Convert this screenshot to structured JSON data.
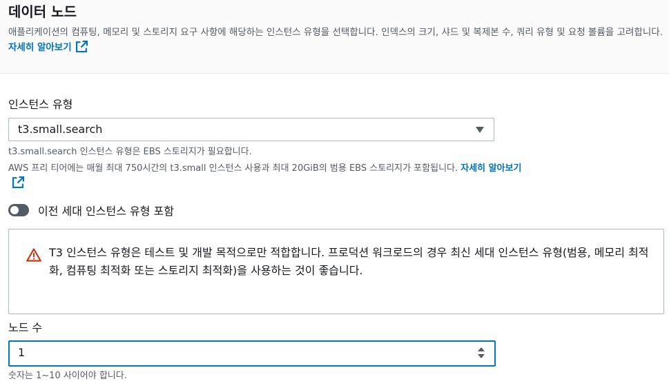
{
  "header": {
    "title": "데이터 노드",
    "description": "애플리케이션의 컴퓨팅, 메모리 및 스토리지 요구 사항에 해당하는 인스턴스 유형을 선택합니다. 인덱스의 크기, 샤드 및 복제본 수, 쿼리 유형 및 요청 볼륨을 고려합니다.",
    "learn_more": "자세히 알아보기"
  },
  "instance_type": {
    "label": "인스턴스 유형",
    "selected": "t3.small.search",
    "hint_ebs": "t3.small.search 인스턴스 유형은 EBS 스토리지가 필요합니다.",
    "hint_free_tier": "AWS 프리 티어에는 매월 최대 750시간의 t3.small 인스턴스 사용과 최대 20GiB의 범용 EBS 스토리지가 포함됩니다.",
    "learn_more": "자세히 알아보기"
  },
  "previous_gen_toggle": {
    "label": "이전 세대 인스턴스 유형 포함",
    "enabled": false
  },
  "alert": {
    "type": "warning",
    "text": "T3 인스턴스 유형은 테스트 및 개발 목적으로만 적합합니다. 프로덕션 워크로드의 경우 최신 세대 인스턴스 유형(범용, 메모리 최적화, 컴퓨팅 최적화 또는 스토리지 최적화)을 사용하는 것이 좋습니다."
  },
  "node_count": {
    "label": "노드 수",
    "value": "1",
    "hint": "숫자는 1~10 사이어야 합니다."
  },
  "colors": {
    "link": "#0073bb",
    "warning": "#d13212",
    "focus_border": "#0073bb"
  },
  "icons": {
    "external_link": "external-link-icon",
    "warning": "warning-icon",
    "dropdown": "caret-down-icon"
  }
}
